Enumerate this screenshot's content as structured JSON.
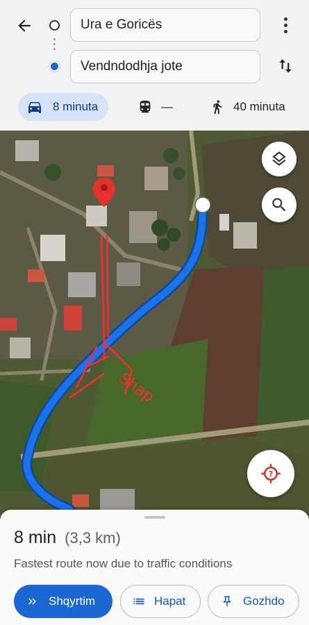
{
  "header": {
    "origin_value": "Ura e Goricës",
    "destination_value": "Vendndodhja jote"
  },
  "modes": {
    "car": "8 minuta",
    "transit": "—",
    "walk": "40 minuta"
  },
  "map": {
    "map_annotation": "Shap",
    "colors": {
      "route": "#1a73e8",
      "route_outline": "#0d47a1",
      "pin": "#e4312b",
      "annotation": "#ff2a2a"
    }
  },
  "sheet": {
    "duration": "8 min",
    "distance": "(3,3 km)",
    "note": "Fastest route now due to traffic conditions",
    "buttons": {
      "preview": "Shqyrtim",
      "steps": "Hapat",
      "pin": "Gozhdo"
    }
  },
  "icons": [
    "back-arrow-icon",
    "origin-circle-icon",
    "location-dot-icon",
    "more-vert-icon",
    "swap-icon",
    "car-icon",
    "train-icon",
    "walk-icon",
    "layers-icon",
    "search-icon",
    "my-location-icon",
    "chevron-right-double-icon",
    "list-icon",
    "pin-icon",
    "map-pin-icon"
  ]
}
